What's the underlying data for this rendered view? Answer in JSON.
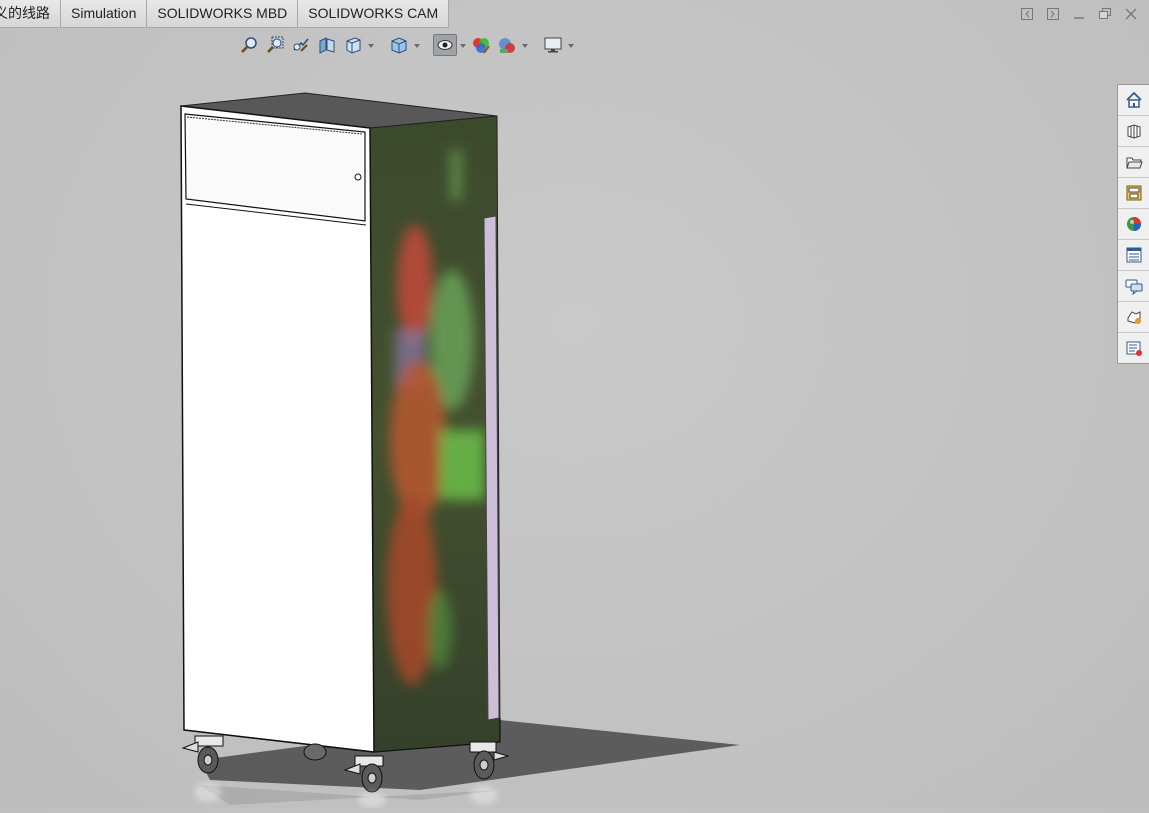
{
  "tabs": [
    {
      "label": "义的线路"
    },
    {
      "label": "Simulation"
    },
    {
      "label": "SOLIDWORKS MBD"
    },
    {
      "label": "SOLIDWORKS CAM"
    }
  ],
  "window_controls": [
    "restore-left-icon",
    "restore-right-icon",
    "minimize-icon",
    "maximize-icon",
    "close-icon"
  ],
  "heads_up_toolbar": [
    "zoom-to-fit-icon",
    "zoom-to-area-icon",
    "previous-view-icon",
    "section-view-icon",
    "view-orientation-icon",
    "display-style-icon",
    "hide-show-items-icon",
    "edit-appearance-icon",
    "apply-scene-icon",
    "view-settings-icon"
  ],
  "task_pane": [
    "solidworks-resources-icon",
    "design-library-icon",
    "file-explorer-icon",
    "view-palette-icon",
    "appearances-scenes-icon",
    "custom-properties-icon",
    "forum-icon",
    "3dexperience-marketplace-icon",
    "property-manager-icon"
  ],
  "colors": {
    "background": "#c4c4c4",
    "cabinet_front": "#ffffff",
    "cabinet_side": "#3f4f2e",
    "cabinet_top": "#585858",
    "door_strip": "#c9b9d4"
  }
}
